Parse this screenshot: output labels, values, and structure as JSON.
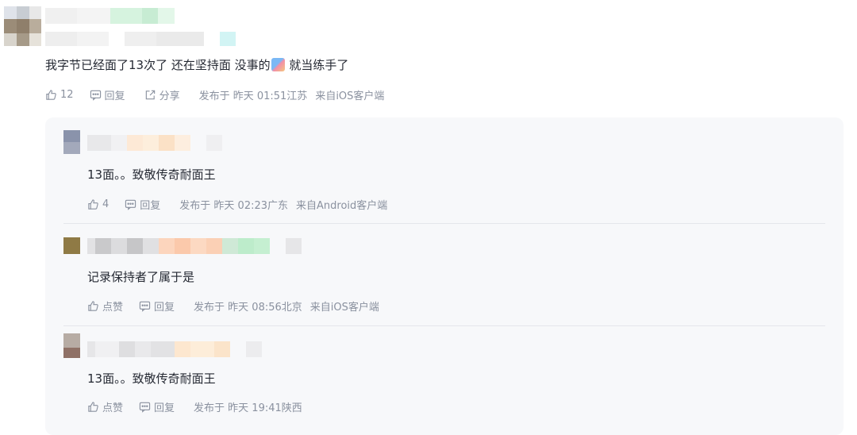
{
  "comment": {
    "text_part1": "我字节已经面了13次了 还在坚持面 没事的",
    "text_part2": " 就当练手了",
    "like_count": "12",
    "reply_label": "回复",
    "share_label": "分享",
    "published": "发布于 昨天 01:51江苏",
    "source": "来自iOS客户端"
  },
  "replies": [
    {
      "text": "13面。。致敬传奇耐面王",
      "like_label": "4",
      "reply_label": "回复",
      "published": "发布于 昨天 02:23广东",
      "source": "来自Android客户端"
    },
    {
      "text": "记录保持者了属于是",
      "like_label": "点赞",
      "reply_label": "回复",
      "published": "发布于 昨天 08:56北京",
      "source": "来自iOS客户端"
    },
    {
      "text": "13面。。致敬传奇耐面王",
      "like_label": "点赞",
      "reply_label": "回复",
      "published": "发布于 昨天 19:41陕西",
      "source": ""
    }
  ],
  "colors": {
    "text": "#252933",
    "meta": "#8a919f",
    "reply_bg": "#f7f8fa"
  },
  "icons": [
    "thumb-up-icon",
    "comment-icon",
    "share-icon",
    "emoji-icon"
  ]
}
